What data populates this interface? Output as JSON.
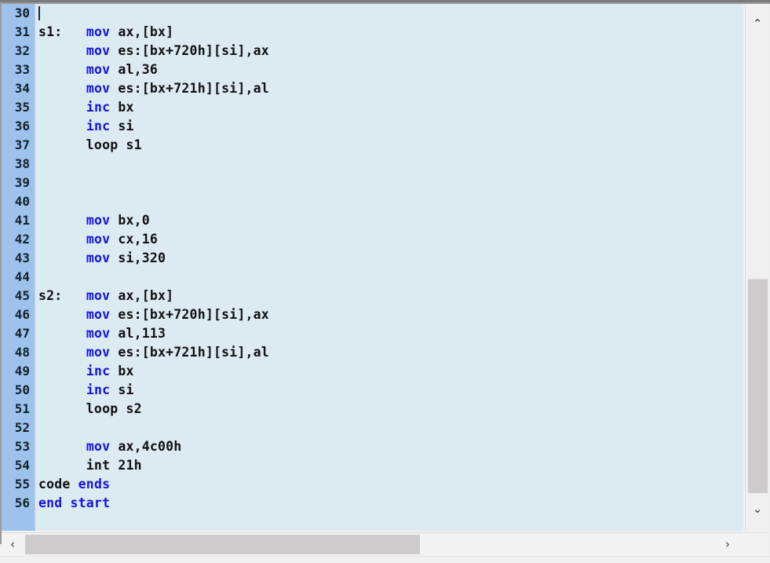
{
  "editor": {
    "first_line_number": 30,
    "line_height_px": 24,
    "colors": {
      "code_background": "#dceaf2",
      "gutter_background": "#9dc3ec",
      "keyword": "#1414e0",
      "plain_text": "#101010",
      "scrollbar_thumb": "#cdcbcb",
      "scrollbar_track": "#f1f0f0",
      "frame_border": "#7b7b7b"
    },
    "lines": [
      {
        "n": "30",
        "spans": []
      },
      {
        "n": "31",
        "spans": [
          {
            "t": "s1:   ",
            "k": false
          },
          {
            "t": "mov",
            "k": true
          },
          {
            "t": " ax,[bx]",
            "k": false
          }
        ]
      },
      {
        "n": "32",
        "spans": [
          {
            "t": "      ",
            "k": false
          },
          {
            "t": "mov",
            "k": true
          },
          {
            "t": " es:[bx+720h][si],ax",
            "k": false
          }
        ]
      },
      {
        "n": "33",
        "spans": [
          {
            "t": "      ",
            "k": false
          },
          {
            "t": "mov",
            "k": true
          },
          {
            "t": " al,36",
            "k": false
          }
        ]
      },
      {
        "n": "34",
        "spans": [
          {
            "t": "      ",
            "k": false
          },
          {
            "t": "mov",
            "k": true
          },
          {
            "t": " es:[bx+721h][si],al",
            "k": false
          }
        ]
      },
      {
        "n": "35",
        "spans": [
          {
            "t": "      ",
            "k": false
          },
          {
            "t": "inc",
            "k": true
          },
          {
            "t": " bx",
            "k": false
          }
        ]
      },
      {
        "n": "36",
        "spans": [
          {
            "t": "      ",
            "k": false
          },
          {
            "t": "inc",
            "k": true
          },
          {
            "t": " si",
            "k": false
          }
        ]
      },
      {
        "n": "37",
        "spans": [
          {
            "t": "      loop s1",
            "k": false
          }
        ]
      },
      {
        "n": "38",
        "spans": []
      },
      {
        "n": "39",
        "spans": []
      },
      {
        "n": "40",
        "spans": []
      },
      {
        "n": "41",
        "spans": [
          {
            "t": "      ",
            "k": false
          },
          {
            "t": "mov",
            "k": true
          },
          {
            "t": " bx,0",
            "k": false
          }
        ]
      },
      {
        "n": "42",
        "spans": [
          {
            "t": "      ",
            "k": false
          },
          {
            "t": "mov",
            "k": true
          },
          {
            "t": " cx,16",
            "k": false
          }
        ]
      },
      {
        "n": "43",
        "spans": [
          {
            "t": "      ",
            "k": false
          },
          {
            "t": "mov",
            "k": true
          },
          {
            "t": " si,320",
            "k": false
          }
        ]
      },
      {
        "n": "44",
        "spans": []
      },
      {
        "n": "45",
        "spans": [
          {
            "t": "s2:   ",
            "k": false
          },
          {
            "t": "mov",
            "k": true
          },
          {
            "t": " ax,[bx]",
            "k": false
          }
        ]
      },
      {
        "n": "46",
        "spans": [
          {
            "t": "      ",
            "k": false
          },
          {
            "t": "mov",
            "k": true
          },
          {
            "t": " es:[bx+720h][si],ax",
            "k": false
          }
        ]
      },
      {
        "n": "47",
        "spans": [
          {
            "t": "      ",
            "k": false
          },
          {
            "t": "mov",
            "k": true
          },
          {
            "t": " al,113",
            "k": false
          }
        ]
      },
      {
        "n": "48",
        "spans": [
          {
            "t": "      ",
            "k": false
          },
          {
            "t": "mov",
            "k": true
          },
          {
            "t": " es:[bx+721h][si],al",
            "k": false
          }
        ]
      },
      {
        "n": "49",
        "spans": [
          {
            "t": "      ",
            "k": false
          },
          {
            "t": "inc",
            "k": true
          },
          {
            "t": " bx",
            "k": false
          }
        ]
      },
      {
        "n": "50",
        "spans": [
          {
            "t": "      ",
            "k": false
          },
          {
            "t": "inc",
            "k": true
          },
          {
            "t": " si",
            "k": false
          }
        ]
      },
      {
        "n": "51",
        "spans": [
          {
            "t": "      loop s2",
            "k": false
          }
        ]
      },
      {
        "n": "52",
        "spans": []
      },
      {
        "n": "53",
        "spans": [
          {
            "t": "      ",
            "k": false
          },
          {
            "t": "mov",
            "k": true
          },
          {
            "t": " ax,4c00h",
            "k": false
          }
        ]
      },
      {
        "n": "54",
        "spans": [
          {
            "t": "      int 21h",
            "k": false
          }
        ]
      },
      {
        "n": "55",
        "spans": [
          {
            "t": "code ",
            "k": false
          },
          {
            "t": "ends",
            "k": true
          }
        ]
      },
      {
        "n": "56",
        "spans": [
          {
            "t": "end start",
            "k": true
          }
        ]
      }
    ]
  },
  "scrollbars": {
    "vertical": {
      "up_arrow_glyph": "⌃",
      "down_arrow_glyph": "⌄"
    },
    "horizontal": {
      "left_arrow_glyph": "‹",
      "right_arrow_glyph": "›"
    }
  }
}
